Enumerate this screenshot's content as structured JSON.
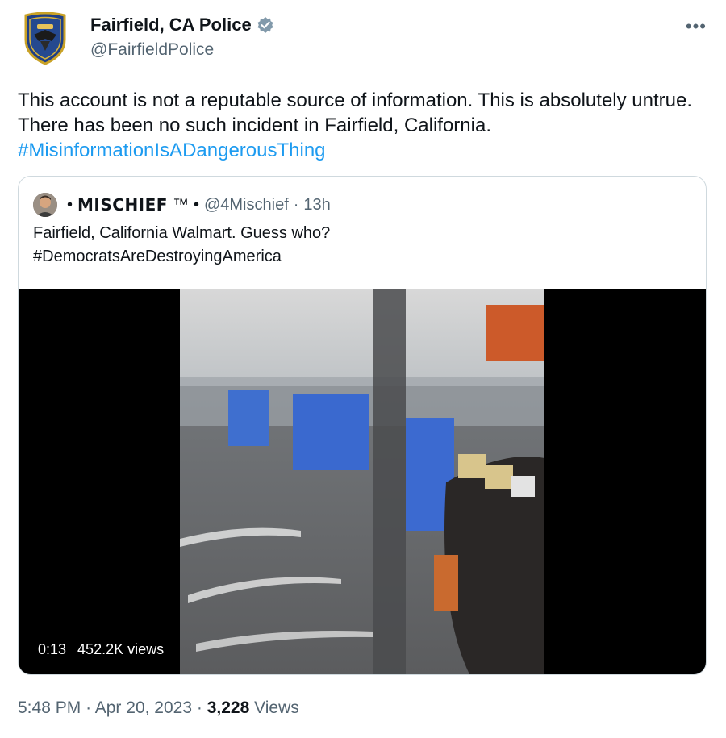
{
  "author": {
    "name": "Fairfield, CA Police",
    "handle": "@FairfieldPolice",
    "verified_color": "#829aab"
  },
  "more_label": "•••",
  "tweet": {
    "text": "This account is not a reputable source of information. This is absolutely untrue. There has been no such incident in Fairfield, California.",
    "hashtag": "#MisinformationIsADangerousThing"
  },
  "quote": {
    "name_prefix": "•",
    "name": "MISCHIEF",
    "tm": "™",
    "sep": "•",
    "handle": "@4Mischief",
    "dot": "·",
    "age": "13h",
    "line1": "Fairfield, California Walmart. Guess who?",
    "line2": "#DemocratsAreDestroyingAmerica",
    "video": {
      "time": "0:13",
      "views": "452.2K views"
    }
  },
  "meta": {
    "time": "5:48 PM",
    "dot1": "·",
    "date": "Apr 20, 2023",
    "dot2": "·",
    "view_count": "3,228",
    "view_label": "Views"
  },
  "colors": {
    "link": "#1d9bf0",
    "muted": "#536471",
    "text": "#0f1419",
    "border": "#cfd9de"
  }
}
